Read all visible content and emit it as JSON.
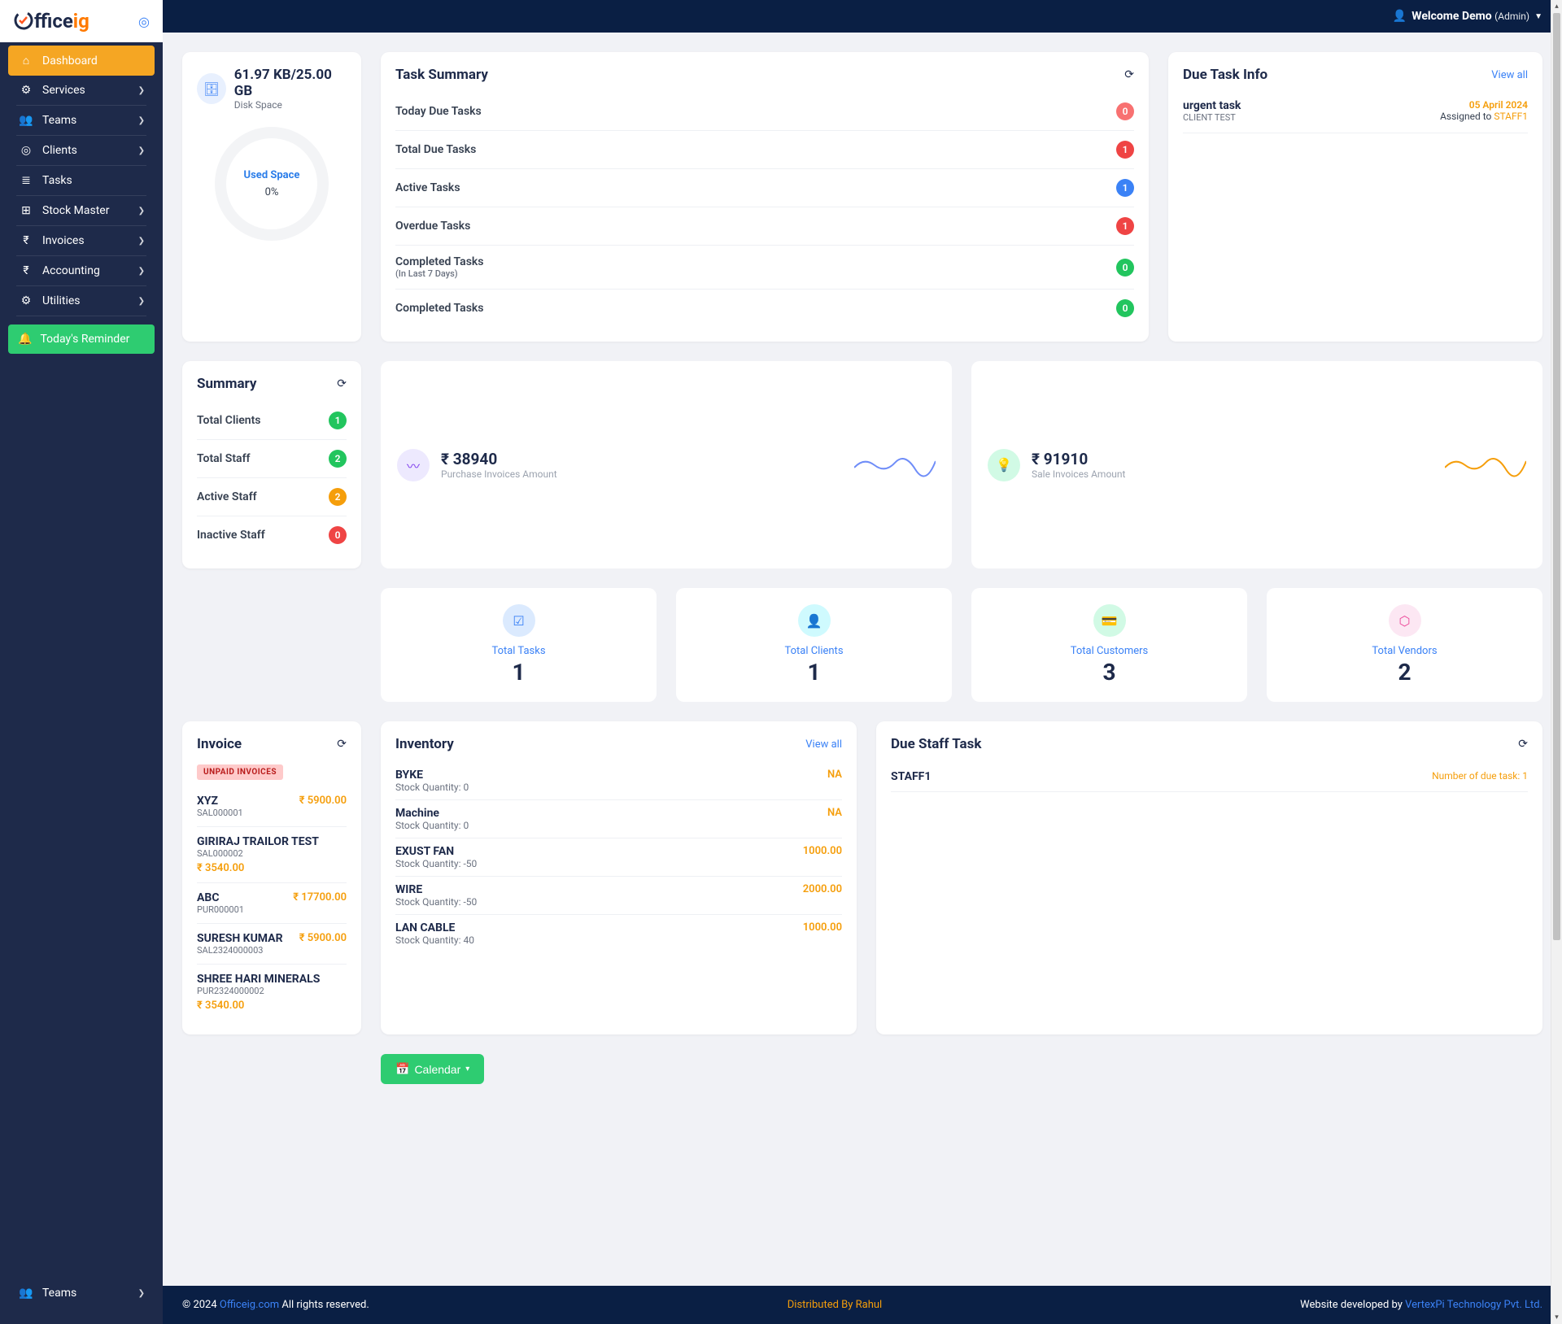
{
  "logo": {
    "c": "O",
    "ffice": "ffice",
    "ig": "ig"
  },
  "topbar": {
    "welcome": "Welcome Demo",
    "role": "(Admin)"
  },
  "sidebar": {
    "items": [
      {
        "icon": "⌂",
        "label": "Dashboard",
        "active": true,
        "chev": false
      },
      {
        "icon": "⚙",
        "label": "Services",
        "chev": true
      },
      {
        "icon": "👥",
        "label": "Teams",
        "chev": true
      },
      {
        "icon": "◎",
        "label": "Clients",
        "chev": true
      },
      {
        "icon": "≣",
        "label": "Tasks",
        "chev": false
      },
      {
        "icon": "⊞",
        "label": "Stock Master",
        "chev": true
      },
      {
        "icon": "₹",
        "label": "Invoices",
        "chev": true
      },
      {
        "icon": "₹",
        "label": "Accounting",
        "chev": true
      },
      {
        "icon": "⚙",
        "label": "Utilities",
        "chev": true
      }
    ],
    "reminder": "Today's Reminder",
    "bottom": {
      "icon": "👥",
      "label": "Teams"
    }
  },
  "disk": {
    "title": "61.97 KB/25.00 GB",
    "sub": "Disk Space",
    "used_label": "Used Space",
    "pct": "0%"
  },
  "task_summary": {
    "title": "Task Summary",
    "rows": [
      {
        "label": "Today Due Tasks",
        "count": "0",
        "cls": "b-lred"
      },
      {
        "label": "Total Due Tasks",
        "count": "1",
        "cls": "b-red"
      },
      {
        "label": "Active Tasks",
        "count": "1",
        "cls": "b-blue"
      },
      {
        "label": "Overdue Tasks",
        "count": "1",
        "cls": "b-red"
      },
      {
        "label": "Completed Tasks",
        "sub": "(In Last 7 Days)",
        "count": "0",
        "cls": "b-green"
      },
      {
        "label": "Completed Tasks",
        "count": "0",
        "cls": "b-green"
      }
    ]
  },
  "due_task": {
    "title": "Due Task Info",
    "view_all": "View all",
    "items": [
      {
        "title": "urgent task",
        "client": "CLIENT TEST",
        "date": "05 April 2024",
        "assigned": "Assigned to ",
        "staff": "STAFF1"
      }
    ]
  },
  "summary": {
    "title": "Summary",
    "rows": [
      {
        "label": "Total Clients",
        "count": "1",
        "cls": "b-green"
      },
      {
        "label": "Total Staff",
        "count": "2",
        "cls": "b-green"
      },
      {
        "label": "Active Staff",
        "count": "2",
        "cls": "b-orange"
      },
      {
        "label": "Inactive Staff",
        "count": "0",
        "cls": "b-red"
      }
    ]
  },
  "kpis": [
    {
      "value": "₹ 38940",
      "label": "Purchase Invoices Amount",
      "cls": "purple",
      "icon": "〰",
      "spark_color": "#6f8df8"
    },
    {
      "value": "₹ 91910",
      "label": "Sale Invoices Amount",
      "cls": "green",
      "icon": "💡",
      "spark_color": "#f59e0b"
    }
  ],
  "stats": [
    {
      "label": "Total Tasks",
      "value": "1",
      "cls": "blue",
      "icon": "☑"
    },
    {
      "label": "Total Clients",
      "value": "1",
      "cls": "cyan",
      "icon": "👤"
    },
    {
      "label": "Total Customers",
      "value": "3",
      "cls": "grn",
      "icon": "💳"
    },
    {
      "label": "Total Vendors",
      "value": "2",
      "cls": "pink",
      "icon": "⬡"
    }
  ],
  "invoice": {
    "title": "Invoice",
    "tag": "UNPAID INVOICES",
    "items": [
      {
        "name": "XYZ",
        "ref": "SAL000001",
        "amt": "₹ 5900.00",
        "inline": true
      },
      {
        "name": "GIRIRAJ TRAILOR TEST",
        "ref": "SAL000002",
        "amt": "₹ 3540.00",
        "inline": false
      },
      {
        "name": "ABC",
        "ref": "PUR000001",
        "amt": "₹ 17700.00",
        "inline": true
      },
      {
        "name": "SURESH KUMAR",
        "ref": "SAL2324000003",
        "amt": "₹ 5900.00",
        "inline": true
      },
      {
        "name": "SHREE HARI MINERALS",
        "ref": "PUR2324000002",
        "amt": "₹ 3540.00",
        "inline": false
      }
    ]
  },
  "inventory": {
    "title": "Inventory",
    "view_all": "View all",
    "items": [
      {
        "name": "BYKE",
        "sub": "Stock Quantity: 0",
        "val": "NA"
      },
      {
        "name": "Machine",
        "sub": "Stock Quantity: 0",
        "val": "NA"
      },
      {
        "name": "EXUST FAN",
        "sub": "Stock Quantity: -50",
        "val": "1000.00"
      },
      {
        "name": "WIRE",
        "sub": "Stock Quantity: -50",
        "val": "2000.00"
      },
      {
        "name": "LAN CABLE",
        "sub": "Stock Quantity: 40",
        "val": "1000.00"
      }
    ]
  },
  "due_staff": {
    "title": "Due Staff Task",
    "items": [
      {
        "name": "STAFF1",
        "due": "Number of due task: 1"
      }
    ]
  },
  "calendar_btn": "Calendar",
  "footer": {
    "left_pre": "© 2024 ",
    "left_link": "Officeig.com",
    "left_post": " All rights reserved.",
    "center": "Distributed By Rahul",
    "right_pre": "Website developed by ",
    "right_link": "VertexPi Technology Pvt. Ltd."
  }
}
